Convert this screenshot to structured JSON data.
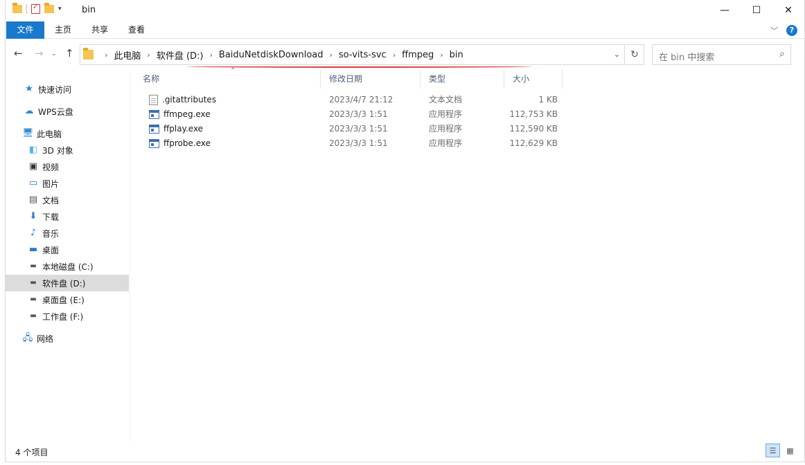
{
  "window": {
    "title": "bin",
    "controls": {
      "minimize": "—",
      "maximize": "☐",
      "close": "✕"
    }
  },
  "ribbon": {
    "tabs": [
      "文件",
      "主页",
      "共享",
      "查看"
    ]
  },
  "address": {
    "crumbs": [
      "此电脑",
      "软件盘 (D:)",
      "BaiduNetdiskDownload",
      "so-vits-svc",
      "ffmpeg",
      "bin"
    ],
    "search_placeholder": "在 bin 中搜索"
  },
  "sidebar": {
    "items": [
      {
        "label": "快速访问",
        "icon": "star-icon"
      },
      {
        "label": "WPS云盘",
        "icon": "cloud-icon"
      },
      {
        "label": "此电脑",
        "icon": "computer-icon"
      },
      {
        "label": "3D 对象",
        "icon": "cube-icon"
      },
      {
        "label": "视频",
        "icon": "video-icon"
      },
      {
        "label": "图片",
        "icon": "picture-icon"
      },
      {
        "label": "文档",
        "icon": "document-icon"
      },
      {
        "label": "下载",
        "icon": "download-icon"
      },
      {
        "label": "音乐",
        "icon": "music-icon"
      },
      {
        "label": "桌面",
        "icon": "desktop-icon"
      },
      {
        "label": "本地磁盘 (C:)",
        "icon": "drive-icon"
      },
      {
        "label": "软件盘 (D:)",
        "icon": "drive-icon",
        "selected": true
      },
      {
        "label": "桌面盘 (E:)",
        "icon": "drive-icon"
      },
      {
        "label": "工作盘 (F:)",
        "icon": "drive-icon"
      },
      {
        "label": "网络",
        "icon": "network-icon"
      }
    ]
  },
  "columns": {
    "name": "名称",
    "date": "修改日期",
    "type": "类型",
    "size": "大小"
  },
  "files": [
    {
      "name": ".gitattributes",
      "date": "2023/4/7 21:12",
      "type": "文本文档",
      "size": "1 KB",
      "icon": "text-file-icon"
    },
    {
      "name": "ffmpeg.exe",
      "date": "2023/3/3 1:51",
      "type": "应用程序",
      "size": "112,753 KB",
      "icon": "exe-file-icon"
    },
    {
      "name": "ffplay.exe",
      "date": "2023/3/3 1:51",
      "type": "应用程序",
      "size": "112,590 KB",
      "icon": "exe-file-icon"
    },
    {
      "name": "ffprobe.exe",
      "date": "2023/3/3 1:51",
      "type": "应用程序",
      "size": "112,629 KB",
      "icon": "exe-file-icon"
    }
  ],
  "status": {
    "item_count": "4 个项目"
  },
  "colors": {
    "accent": "#1979ca",
    "annotation": "#e03a3a",
    "selection": "#dcdcdc"
  }
}
